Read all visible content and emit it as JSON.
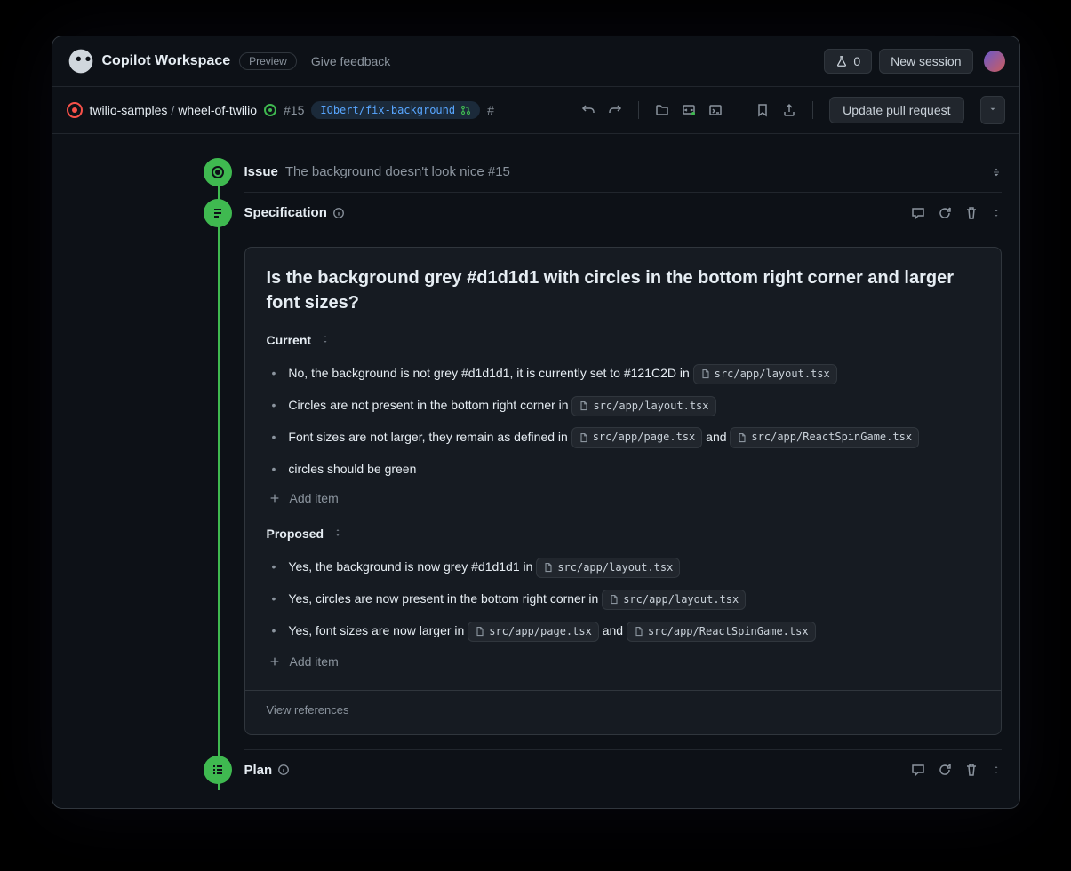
{
  "header": {
    "logo_text": "Copilot Workspace",
    "preview_badge": "Preview",
    "feedback_link": "Give feedback",
    "flask_count": "0",
    "new_session": "New session"
  },
  "subheader": {
    "owner": "twilio-samples",
    "repo": "wheel-of-twilio",
    "issue_number": "#15",
    "branch": "IObert/fix-background",
    "hash_prefix": "#",
    "update_pr": "Update pull request"
  },
  "issue": {
    "label": "Issue",
    "title": "The background doesn't look nice #15"
  },
  "specification": {
    "label": "Specification",
    "question": "Is the background grey #d1d1d1 with circles in the bottom right corner and larger font sizes?",
    "current_label": "Current",
    "current_items": [
      {
        "text_before": "No, the background is not grey #d1d1d1, it is currently set to #121C2D in ",
        "chip": "src/app/layout.tsx",
        "text_after": ""
      },
      {
        "text_before": "Circles are not present in the bottom right corner in ",
        "chip": "src/app/layout.tsx",
        "text_after": ""
      },
      {
        "text_before": "Font sizes are not larger, they remain as defined in ",
        "chip": "src/app/page.tsx",
        "text_mid": " and ",
        "chip2": "src/app/ReactSpinGame.tsx",
        "text_after": ""
      },
      {
        "text_before": "circles should be green",
        "chip": "",
        "text_after": ""
      }
    ],
    "proposed_label": "Proposed",
    "proposed_items": [
      {
        "text_before": "Yes, the background is now grey #d1d1d1 in ",
        "chip": "src/app/layout.tsx",
        "text_after": ""
      },
      {
        "text_before": "Yes, circles are now present in the bottom right corner in ",
        "chip": "src/app/layout.tsx",
        "text_after": ""
      },
      {
        "text_before": "Yes, font sizes are now larger in ",
        "chip": "src/app/page.tsx",
        "text_mid": " and ",
        "chip2": "src/app/ReactSpinGame.tsx",
        "text_after": ""
      }
    ],
    "add_item": "Add item",
    "view_references": "View references"
  },
  "plan": {
    "label": "Plan"
  }
}
